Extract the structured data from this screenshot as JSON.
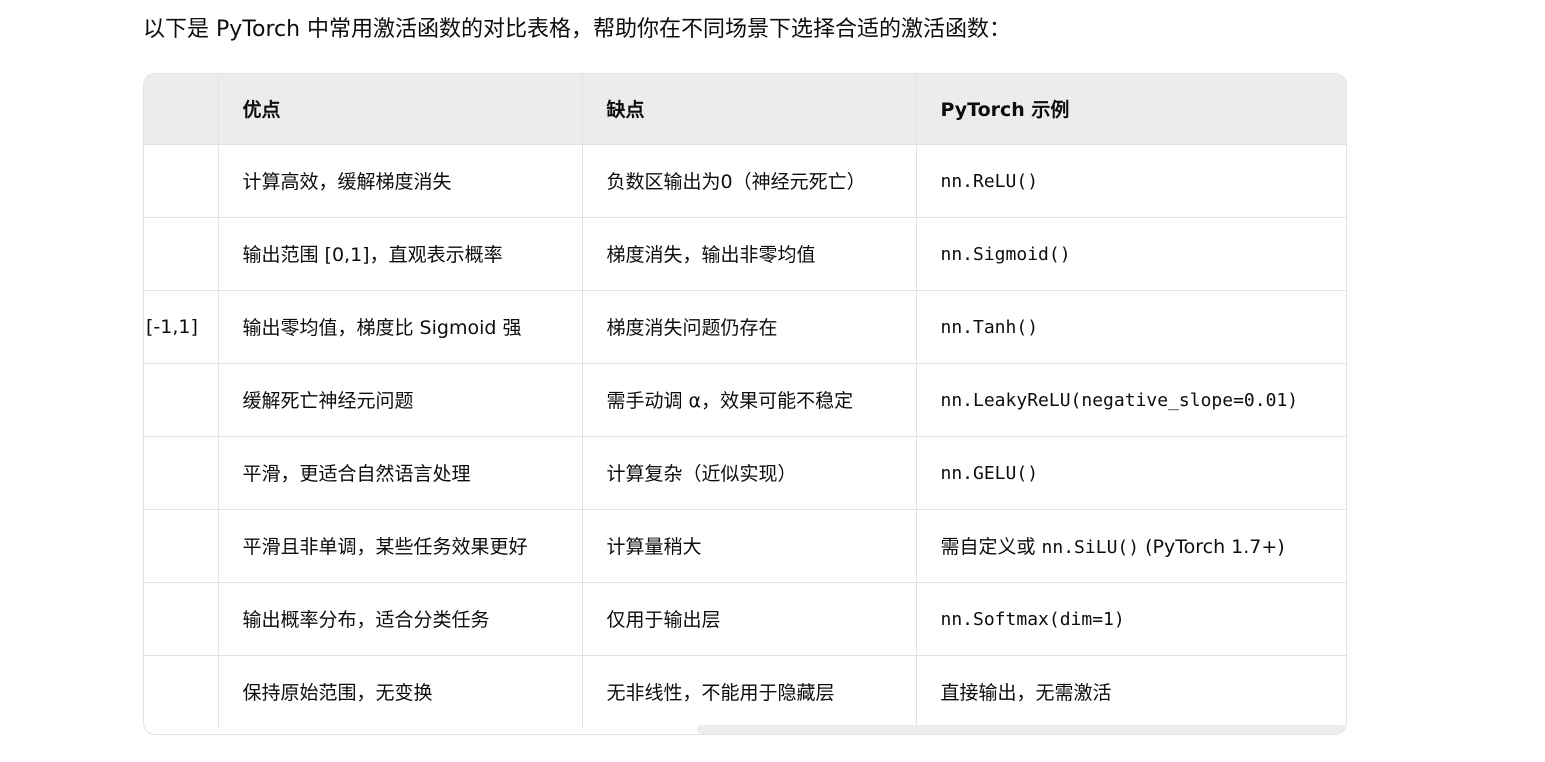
{
  "intro": "以下是 PyTorch 中常用激活函数的对比表格，帮助你在不同场景下选择合适的激活函数：",
  "table": {
    "headers": [
      "",
      "优点",
      "缺点",
      "PyTorch 示例"
    ],
    "rows": [
      {
        "name": "",
        "pros": "计算高效，缓解梯度消失",
        "cons": "负数区输出为0（神经元死亡）",
        "example": "nn.ReLU()"
      },
      {
        "name": "",
        "pros": "输出范围 [0,1]，直观表示概率",
        "cons": "梯度消失，输出非零均值",
        "example": "nn.Sigmoid()"
      },
      {
        "name": "[-1,1]",
        "pros": "输出零均值，梯度比 Sigmoid 强",
        "cons": "梯度消失问题仍存在",
        "example": "nn.Tanh()"
      },
      {
        "name": "",
        "pros": "缓解死亡神经元问题",
        "cons": "需手动调 α，效果可能不稳定",
        "example": "nn.LeakyReLU(negative_slope=0.01)"
      },
      {
        "name": "",
        "pros": "平滑，更适合自然语言处理",
        "cons": "计算复杂（近似实现）",
        "example": "nn.GELU()"
      },
      {
        "name": "",
        "pros": "平滑且非单调，某些任务效果更好",
        "cons": "计算量稍大",
        "example_prefix": "需自定义或 ",
        "example_code": "nn.SiLU()",
        "example_suffix": " (PyTorch 1.7+)"
      },
      {
        "name": "",
        "pros": "输出概率分布，适合分类任务",
        "cons": "仅用于输出层",
        "example": "nn.Softmax(dim=1)"
      },
      {
        "name": "",
        "pros": "保持原始范围，无变换",
        "cons": "无非线性，不能用于隐藏层",
        "example_text": "直接输出，无需激活"
      }
    ]
  }
}
